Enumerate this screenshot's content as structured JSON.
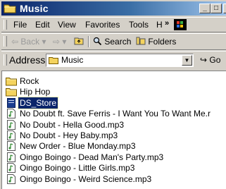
{
  "window": {
    "title": "Music"
  },
  "titlebar_buttons": {
    "minimize": "_",
    "maximize": "□",
    "close": "×"
  },
  "menu": {
    "items": [
      "File",
      "Edit",
      "View",
      "Favorites",
      "Tools",
      "H"
    ],
    "chevron": "»"
  },
  "toolbar": {
    "back_label": "Back",
    "search_label": "Search",
    "folders_label": "Folders"
  },
  "address": {
    "label": "Address",
    "value": "Music",
    "go_label": "Go"
  },
  "files": [
    {
      "name": "Rock",
      "type": "folder-icon"
    },
    {
      "name": "Hip Hop",
      "type": "folder-icon"
    },
    {
      "name": "DS_Store",
      "type": "file-icon",
      "selected": true
    },
    {
      "name": "No Doubt ft. Save Ferris - I Want You To Want Me.r",
      "type": "mp3-icon"
    },
    {
      "name": "No Doubt - Hella Good.mp3",
      "type": "mp3-icon"
    },
    {
      "name": "No Doubt - Hey Baby.mp3",
      "type": "mp3-icon"
    },
    {
      "name": "New Order - Blue Monday.mp3",
      "type": "mp3-icon"
    },
    {
      "name": "Oingo Boingo - Dead Man's Party.mp3",
      "type": "mp3-icon"
    },
    {
      "name": "Oingo Boingo - Little Girls.mp3",
      "type": "mp3-icon"
    },
    {
      "name": "Oingo Boingo - Weird Science.mp3",
      "type": "mp3-icon"
    }
  ],
  "colors": {
    "title_active": "#0a246a",
    "selection": "#0a246a",
    "chrome": "#d4d0c8"
  }
}
